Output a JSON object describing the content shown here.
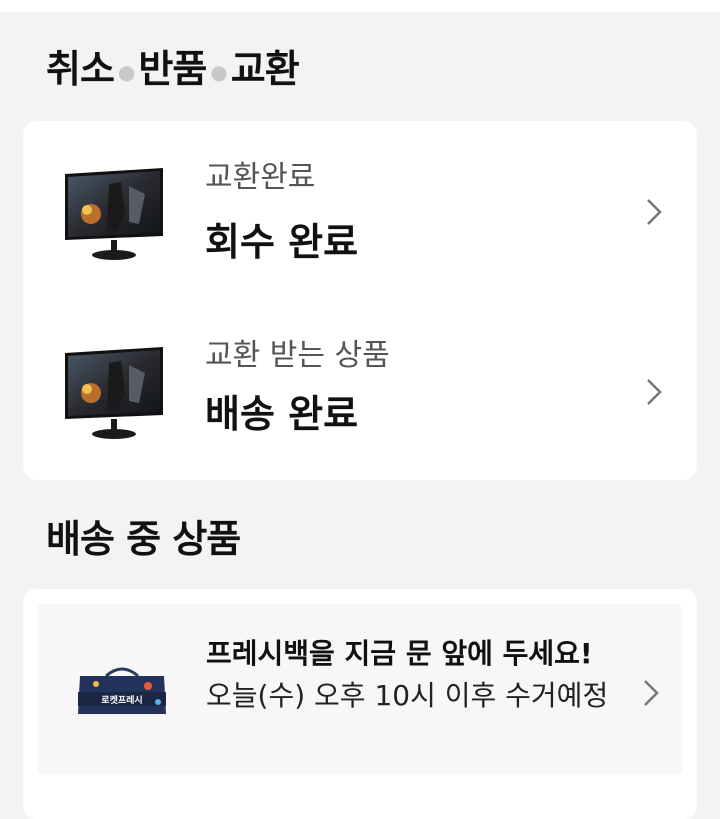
{
  "section_cancel": {
    "part1": "취소",
    "part2": "반품",
    "part3": "교환"
  },
  "exchange_items": [
    {
      "subtitle": "교환완료",
      "status": "회수 완료",
      "icon": "monitor-thumbnail"
    },
    {
      "subtitle": "교환 받는 상품",
      "status": "배송 완료",
      "icon": "monitor-thumbnail"
    }
  ],
  "section_shipping": {
    "title": "배송 중 상품"
  },
  "fresh_notice": {
    "title": "프레시백을 지금 문 앞에 두세요!",
    "detail": "오늘(수) 오후 10시 이후 수거예정",
    "bag_label": "로켓프레시",
    "icon": "fresh-bag-icon"
  }
}
